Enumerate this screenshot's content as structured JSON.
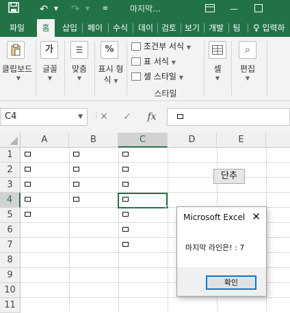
{
  "window": {
    "title": "마지막...",
    "save_icon": "save-icon",
    "undo_icon": "undo-icon",
    "redo_icon": "redo-icon",
    "customize_icon": "customize-quick-access-icon",
    "minimize_icon": "minimize-icon",
    "maximize_icon": "maximize-icon"
  },
  "tabs": [
    {
      "label": "파일"
    },
    {
      "label": "홈"
    },
    {
      "label": "삽입"
    },
    {
      "label": "페이"
    },
    {
      "label": "수식"
    },
    {
      "label": "데이"
    },
    {
      "label": "검토"
    },
    {
      "label": "보기"
    },
    {
      "label": "개발"
    },
    {
      "label": "팀"
    }
  ],
  "tell_me": {
    "label": "입력하",
    "icon": "lightbulb-icon"
  },
  "ribbon": {
    "clipboard": "클립보드",
    "font": "글꼴",
    "alignment": "맞춤",
    "number_line1": "표시 형",
    "number_line2": "식",
    "number_symbol": "%",
    "font_symbol": "가",
    "conditional_format": "조건부 서식",
    "format_as_table": "표 서식",
    "cell_styles": "셀 스타일",
    "styles_group": "스타일",
    "cells": "셀",
    "editing": "편집"
  },
  "formula_bar": {
    "name_box": "C4",
    "cancel": "✕",
    "enter": "✓",
    "fx": "fx",
    "content": "□"
  },
  "columns": [
    "A",
    "B",
    "C",
    "D",
    "E"
  ],
  "rows": [
    "1",
    "2",
    "3",
    "4",
    "5",
    "6",
    "7",
    "8",
    "9",
    "10",
    "11"
  ],
  "cells": {
    "A1": "□",
    "B1": "□",
    "C1": "□",
    "A2": "□",
    "B2": "□",
    "C2": "□",
    "A3": "□",
    "B3": "□",
    "C3": "□",
    "A4": "□",
    "B4": "□",
    "C4": "□",
    "A5": "□",
    "C5": "□",
    "C6": "□",
    "C7": "□"
  },
  "selected_cell": "C4",
  "sheet_button": {
    "label": "단추"
  },
  "dialog": {
    "title": "Microsoft Excel",
    "message": "마지막 라인은! : 7",
    "ok_label": "확인"
  }
}
